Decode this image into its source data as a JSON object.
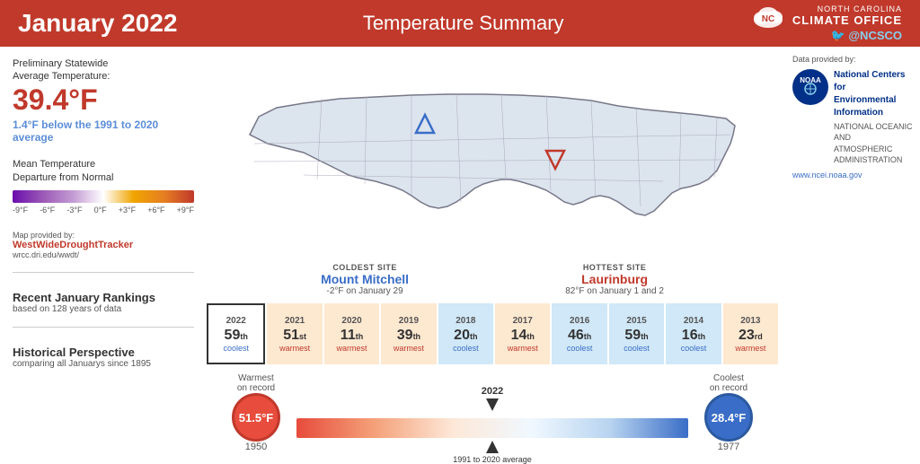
{
  "header": {
    "title": "January 2022",
    "subtitle": "Temperature Summary",
    "logo_line1": "NORTH CAROLINA",
    "logo_line2": "CLIMATE OFFICE",
    "twitter": "@NCSCO"
  },
  "avg_temp": {
    "label": "Preliminary Statewide\nAverage Temperature:",
    "value": "39.4°F",
    "below_text": "below the 1991 to 2020 average",
    "below_amount": "1.4°F"
  },
  "legend": {
    "title": "Mean Temperature\nDeparture from Normal",
    "labels": [
      "-9°F",
      "-6°F",
      "-3°F",
      "0°F",
      "+3°F",
      "+6°F",
      "+9°F"
    ]
  },
  "map_credit": {
    "provided_by": "Map provided by:",
    "link_text": "WestWideDroughtTracker",
    "url": "wrcc.dri.edu/wwdt/"
  },
  "sites": {
    "coldest": {
      "label": "COLDEST SITE",
      "name": "Mount Mitchell",
      "detail": "-2°F on January 29"
    },
    "hottest": {
      "label": "HOTTEST SITE",
      "name": "Laurinburg",
      "detail": "82°F on January 1 and 2"
    }
  },
  "rankings": {
    "title": "Recent January Rankings",
    "subtitle": "based on 128 years of data",
    "cells": [
      {
        "year": "2022",
        "rank": "59",
        "suffix": "th",
        "type": "coolest",
        "highlight": "2022"
      },
      {
        "year": "2021",
        "rank": "51",
        "suffix": "st",
        "type": "warmest",
        "highlight": ""
      },
      {
        "year": "2020",
        "rank": "11",
        "suffix": "th",
        "type": "warmest",
        "highlight": ""
      },
      {
        "year": "2019",
        "rank": "39",
        "suffix": "th",
        "type": "warmest",
        "highlight": ""
      },
      {
        "year": "2018",
        "rank": "20",
        "suffix": "th",
        "type": "coolest",
        "highlight": ""
      },
      {
        "year": "2017",
        "rank": "14",
        "suffix": "th",
        "type": "warmest",
        "highlight": ""
      },
      {
        "year": "2016",
        "rank": "46",
        "suffix": "th",
        "type": "coolest",
        "highlight": ""
      },
      {
        "year": "2015",
        "rank": "59",
        "suffix": "th",
        "type": "coolest",
        "highlight": ""
      },
      {
        "year": "2014",
        "rank": "16",
        "suffix": "th",
        "type": "coolest",
        "highlight": ""
      },
      {
        "year": "2013",
        "rank": "23",
        "suffix": "rd",
        "type": "warmest",
        "highlight": ""
      }
    ]
  },
  "historical": {
    "title": "Historical Perspective",
    "subtitle": "comparing all Januarys since 1895",
    "warmest_label": "Warmest\non record",
    "warmest_temp": "51.5°F",
    "warmest_year": "1950",
    "coolest_label": "Coolest\non record",
    "coolest_temp": "28.4°F",
    "coolest_year": "1977",
    "avg_label": "1991 to 2020 average",
    "current_year": "2022"
  },
  "ncei": {
    "provided_by": "Data provided by:",
    "name": "National Centers for\nEnvironmental Information",
    "url": "www.ncei.noaa.gov"
  }
}
